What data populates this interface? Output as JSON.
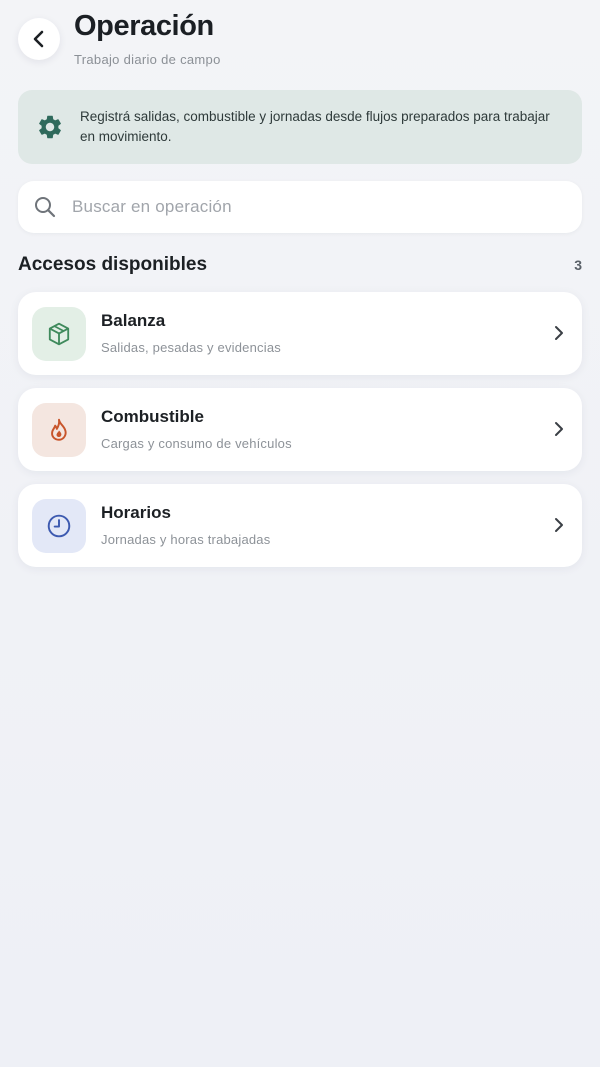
{
  "header": {
    "title": "Operación",
    "subtitle": "Trabajo diario de campo",
    "back_icon": "chevron-left-icon"
  },
  "banner": {
    "icon": "gear-icon",
    "text": "Registrá salidas, combustible y jornadas desde flujos preparados para trabajar en movimiento.",
    "bg_color": "#dfe8e6",
    "icon_color": "#2f6a5c"
  },
  "search": {
    "icon": "search-icon",
    "placeholder": "Buscar en operación",
    "value": ""
  },
  "section": {
    "title": "Accesos disponibles",
    "count": "3"
  },
  "items": [
    {
      "title": "Balanza",
      "subtitle": "Salidas, pesadas y evidencias",
      "icon": "box-icon",
      "tile_color": "#e3efe6",
      "icon_color": "#3f8a5c"
    },
    {
      "title": "Combustible",
      "subtitle": "Cargas y consumo de vehículos",
      "icon": "flame-icon",
      "tile_color": "#f4e6e0",
      "icon_color": "#c8552b"
    },
    {
      "title": "Horarios",
      "subtitle": "Jornadas y horas trabajadas",
      "icon": "clock-icon",
      "tile_color": "#e3e8f7",
      "icon_color": "#3d5ab0"
    }
  ]
}
